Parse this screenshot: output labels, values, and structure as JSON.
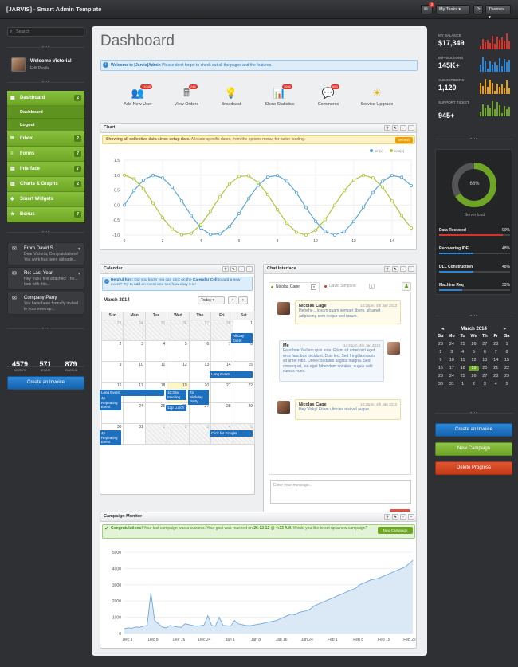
{
  "topbar": {
    "title": "[JARVIS] - Smart Admin Template",
    "badge": "3",
    "my_tasks": "My Tasks",
    "themes": "Themes"
  },
  "sidebar": {
    "search_placeholder": "Search",
    "user_name": "Welcome Victoria!",
    "user_edit": "Edit Profile",
    "nav": [
      {
        "label": "Dashboard",
        "count": "2"
      },
      {
        "label": "Inbox",
        "count": "2"
      },
      {
        "label": "Forms",
        "count": "7"
      },
      {
        "label": "Interface",
        "count": "7"
      },
      {
        "label": "Charts & Graphs",
        "count": "2"
      },
      {
        "label": "Smart Widgets",
        "count": ""
      },
      {
        "label": "Bonus",
        "count": "7"
      }
    ],
    "subnav": [
      "Dashboard",
      "Logout"
    ],
    "messages": [
      {
        "title": "From David S...",
        "body": "Dear Victoria, Congratulations! You work has been uploade..."
      },
      {
        "title": "Re: Last Year",
        "body": "Hey Vicki, find attached! The... look with this..."
      },
      {
        "title": "Company Party",
        "body": "You have been formally invited to your new rep..."
      }
    ],
    "stats": [
      {
        "value": "4579",
        "label": "visitors"
      },
      {
        "value": "571",
        "label": "orders"
      },
      {
        "value": "879",
        "label": "revenue"
      }
    ],
    "create_invoice": "Create an Invoice"
  },
  "main": {
    "page_title": "Dashboard",
    "alert_strong": "Welcome to [Jarvis]Admin",
    "alert_text": " Please don't forget to check out all the pages and the features.",
    "shortcuts": [
      {
        "label": "Add New User",
        "badge": "+1045",
        "icon": "add-user-icon",
        "glyph": "👥",
        "color": "#3c9a2a"
      },
      {
        "label": "View Orders",
        "badge": "246",
        "icon": "orders-icon",
        "glyph": "🖩",
        "color": "#666"
      },
      {
        "label": "Broadcast",
        "badge": "",
        "icon": "broadcast-icon",
        "glyph": "💡",
        "color": "#2a88cf"
      },
      {
        "label": "Show Statistics",
        "badge": "3690",
        "icon": "statistics-icon",
        "glyph": "📊",
        "color": "#d9342b"
      },
      {
        "label": "Comments",
        "badge": "653",
        "icon": "comments-icon",
        "glyph": "💬",
        "color": "#2a88cf"
      },
      {
        "label": "Service Upgrade",
        "badge": "",
        "icon": "upgrade-icon",
        "glyph": "☀",
        "color": "#e8b20c"
      }
    ],
    "chart_panel": {
      "title": "Chart",
      "warn_strong": "Showing all collective data since setup date.",
      "warn_text": " Allocate specific dates, from the options menu, for faster loading.",
      "refresh": "refresh"
    },
    "calendar_panel": {
      "title": "Calendar",
      "hint_strong": "Helpful hint:",
      "hint_text": " Did you know you can click on the ",
      "hint_link": "Calendar Cell",
      "hint_text2": " to add a new event? Try to add an event and see how easy it is!",
      "month": "March 2014",
      "today_btn": "Today",
      "days": [
        "Sun",
        "Mon",
        "Tue",
        "Wed",
        "Thu",
        "Fri",
        "Sat"
      ],
      "weeks": [
        [
          "23",
          "24",
          "25",
          "26",
          "27",
          "28",
          "1"
        ],
        [
          "2",
          "3",
          "4",
          "5",
          "6",
          "7",
          "8"
        ],
        [
          "9",
          "10",
          "11",
          "12",
          "13",
          "14",
          "15"
        ],
        [
          "16",
          "17",
          "18",
          "19",
          "20",
          "21",
          "22"
        ],
        [
          "23",
          "24",
          "25",
          "26",
          "27",
          "28",
          "29"
        ],
        [
          "30",
          "31",
          "1",
          "2",
          "3",
          "4",
          "5"
        ]
      ],
      "events": [
        {
          "text": "All Day Event"
        },
        {
          "text": "Long Event"
        },
        {
          "text": "Long Event"
        },
        {
          "text": "4p Repeating Event"
        },
        {
          "text": "10:30a Meeting"
        },
        {
          "text": "12p Lunch"
        },
        {
          "text": "7p Birthday Party"
        },
        {
          "text": "4p Repeating Event"
        },
        {
          "text": "Click for Google"
        }
      ]
    },
    "chat_panel": {
      "title": "Chat Interface",
      "tab1": "Nicolas Cage",
      "tab1_badge": "2",
      "tab2": "David Simpson",
      "tab2_badge": "1",
      "messages": [
        {
          "name": "Nicolas Cage",
          "date": "14:25pm, 4th Jan 2013",
          "text": "Hehehe... ipsum quam semper libero, sit amet adipiscing sem neque sed ipsum."
        },
        {
          "name": "Me",
          "date": "14:25pm, 4th Jan 2013",
          "text": "Fauciboel Nullam quis ante. Etiam sit amet orci eget eros faucibus tincidunt. Duis leo. Sed fringilla mauris sit amet nibh. Donec sodales sagittis magna. Sed consequat, leo eget bibendum sodales, augue velit cursus nunc."
        },
        {
          "name": "Nicolas Cage",
          "date": "14:25pm, 4th Jan 2013",
          "text": "Hey Vicky! Etiam ultricies nisi vel augue."
        }
      ],
      "input_placeholder": "Enter your message...",
      "send": "Send"
    },
    "campaign_panel": {
      "title": "Campaign Monitor",
      "succ_strong": "Congratulations!",
      "succ_text": " Your last campaign was a success. Your goal was reached on ",
      "succ_date": "26-12-12 @ 4:33 AM",
      "succ_text2": ". Would you like to set up a new campaign?",
      "new_campaign": "New Campaign"
    }
  },
  "right": {
    "sparks": [
      {
        "label": "MY BALANCE",
        "value": "$17,349",
        "color": "#d9342b"
      },
      {
        "label": "IMPRESSIONS",
        "value": "145K+",
        "color": "#2a86d8"
      },
      {
        "label": "SUBSCRIBERS",
        "value": "1,120",
        "color": "#e8a10c"
      },
      {
        "label": "SUPPORT TICKET",
        "value": "945+",
        "color": "#6ea526"
      }
    ],
    "donut_value": "66%",
    "donut_label": "Server load",
    "progress": [
      {
        "label": "Data Restored",
        "value": "90%",
        "fraction": 0.9,
        "color": "#d9342b"
      },
      {
        "label": "Recovering IDE",
        "value": "48%",
        "fraction": 0.48,
        "color": "#2a86d8"
      },
      {
        "label": "DLL Construction",
        "value": "48%",
        "fraction": 0.48,
        "color": "#2a86d8"
      },
      {
        "label": "Machine Req",
        "value": "33%",
        "fraction": 0.33,
        "color": "#2a86d8"
      }
    ],
    "mini_calendar": {
      "month": "March 2014",
      "days": [
        "Su",
        "Mo",
        "Tu",
        "We",
        "Th",
        "Fr",
        "Sa"
      ],
      "cells": [
        "23",
        "24",
        "25",
        "26",
        "27",
        "28",
        "1",
        "2",
        "3",
        "4",
        "5",
        "6",
        "7",
        "8",
        "9",
        "10",
        "11",
        "12",
        "13",
        "14",
        "15",
        "16",
        "17",
        "18",
        "19",
        "20",
        "21",
        "22",
        "23",
        "24",
        "25",
        "26",
        "27",
        "28",
        "29",
        "30",
        "31",
        "1",
        "2",
        "3",
        "4",
        "5"
      ],
      "today": "19"
    },
    "buttons": [
      {
        "label": "Create an Invoice"
      },
      {
        "label": "New Campaign"
      },
      {
        "label": "Delete Progress"
      }
    ]
  },
  "chart_data": [
    {
      "type": "line",
      "title": "",
      "legend": "top-right",
      "xlim": [
        0,
        15
      ],
      "ylim": [
        -1.0,
        1.5
      ],
      "xticks": [
        "0",
        "2",
        "4",
        "6",
        "8",
        "10",
        "12",
        "14"
      ],
      "yticks": [
        "1.5",
        "1.0",
        "0.5",
        "0.0",
        "-0.5",
        "-1.0"
      ],
      "series": [
        {
          "name": "sin(x)",
          "color": "#5aa5d8",
          "x": [
            0,
            0.5,
            1,
            1.5,
            2,
            2.5,
            3,
            3.5,
            4,
            4.5,
            5,
            5.5,
            6,
            6.5,
            7,
            7.5,
            8,
            8.5,
            9,
            9.5,
            10,
            10.5,
            11,
            11.5,
            12,
            12.5,
            13,
            13.5,
            14,
            14.5,
            15
          ],
          "y": [
            0,
            0.48,
            0.84,
            1.0,
            0.91,
            0.6,
            0.14,
            -0.35,
            -0.76,
            -0.98,
            -0.96,
            -0.71,
            -0.28,
            0.22,
            0.66,
            0.94,
            0.99,
            0.8,
            0.41,
            -0.08,
            -0.54,
            -0.88,
            -1.0,
            -0.88,
            -0.54,
            -0.07,
            0.42,
            0.8,
            0.99,
            0.93,
            0.65
          ]
        },
        {
          "name": "cos(x)",
          "color": "#a9c83c",
          "x": [
            0,
            0.5,
            1,
            1.5,
            2,
            2.5,
            3,
            3.5,
            4,
            4.5,
            5,
            5.5,
            6,
            6.5,
            7,
            7.5,
            8,
            8.5,
            9,
            9.5,
            10,
            10.5,
            11,
            11.5,
            12,
            12.5,
            13,
            13.5,
            14,
            14.5,
            15
          ],
          "y": [
            1.0,
            0.88,
            0.54,
            0.07,
            -0.42,
            -0.8,
            -0.99,
            -0.94,
            -0.65,
            -0.21,
            0.28,
            0.71,
            0.96,
            0.98,
            0.75,
            0.35,
            -0.15,
            -0.6,
            -0.91,
            -1.0,
            -0.84,
            -0.48,
            0.0,
            0.48,
            0.84,
            1.0,
            0.91,
            0.6,
            0.14,
            -0.35,
            -0.76
          ]
        }
      ]
    },
    {
      "type": "area",
      "title": "",
      "ylim": [
        0,
        5000
      ],
      "yticks": [
        "5000",
        "4000",
        "3000",
        "2000",
        "1000",
        "0"
      ],
      "xticks": [
        "Dec 1",
        "Dec 8",
        "Dec 16",
        "Dec 24",
        "Jan 1",
        "Jan 8",
        "Jan 16",
        "Jan 24",
        "Feb 1",
        "Feb 8",
        "Feb 15",
        "Feb 22"
      ],
      "series": [
        {
          "name": "",
          "color": "#6fa9dc",
          "values": [
            300,
            350,
            320,
            400,
            380,
            450,
            500,
            2500,
            800,
            600,
            400,
            350,
            500,
            450,
            400,
            380,
            600,
            550,
            500,
            450,
            480,
            520,
            1100,
            500,
            450,
            1000,
            500,
            480,
            450,
            800,
            600,
            550,
            500,
            480,
            520,
            560,
            600,
            650,
            700,
            750,
            800,
            900,
            1000,
            1100,
            1200,
            1150,
            1300,
            1350,
            1400,
            1500,
            1700,
            1800,
            1900,
            2000,
            2100,
            2200,
            2300,
            2400,
            2500,
            2600,
            2700,
            2800,
            3000,
            3100,
            3200,
            3300,
            3350,
            3400,
            3500,
            3600,
            3700,
            3800,
            3900,
            4000,
            4100,
            4300,
            4500
          ]
        }
      ]
    }
  ]
}
